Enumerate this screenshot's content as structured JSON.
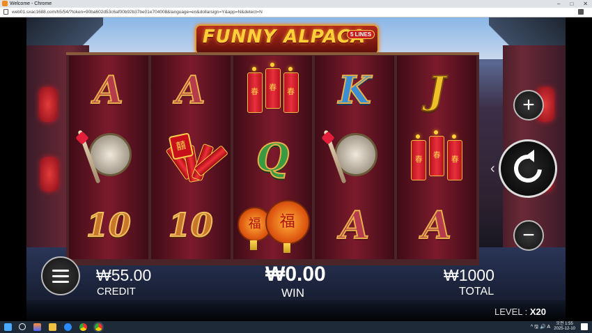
{
  "browser": {
    "window_title": "Welcome - Chrome",
    "url": "web01.sxac1688.com/h5/54/?token=90ba602d53c6af00b92b37be01e704008&language=en&dollarsign=Y&app=N&detect=N",
    "controls": [
      "–",
      "□",
      "✕"
    ]
  },
  "game": {
    "logo_text": "FUNNY ALPACA",
    "lines_badge": "5 LINES",
    "reels": [
      [
        "A",
        "gong",
        "10"
      ],
      [
        "A",
        "firecracker-bundle",
        "10"
      ],
      [
        "firecrackers",
        "Q",
        "lanterns"
      ],
      [
        "K",
        "gong",
        "A"
      ],
      [
        "J",
        "firecrackers",
        "A"
      ]
    ],
    "firecracker_char": "春",
    "lantern_char": "福",
    "bundle_char": "囍",
    "credit": {
      "value": "₩55.00",
      "label": "CREDIT"
    },
    "win": {
      "value": "₩0.00",
      "label": "WIN"
    },
    "total": {
      "value": "₩1000",
      "label": "TOTAL"
    },
    "level": {
      "label": "LEVEL :",
      "value": "X20"
    },
    "buttons": {
      "plus": "+",
      "minus": "−"
    }
  },
  "taskbar": {
    "clock_time": "오전 1:55",
    "clock_date": "2025-12-10",
    "tray": "^ 🖫 🔊 A"
  },
  "colors": {
    "reel_bg": "#7c1a2c",
    "gold": "#ffcf3a",
    "taskbar": "#1f2a38"
  }
}
